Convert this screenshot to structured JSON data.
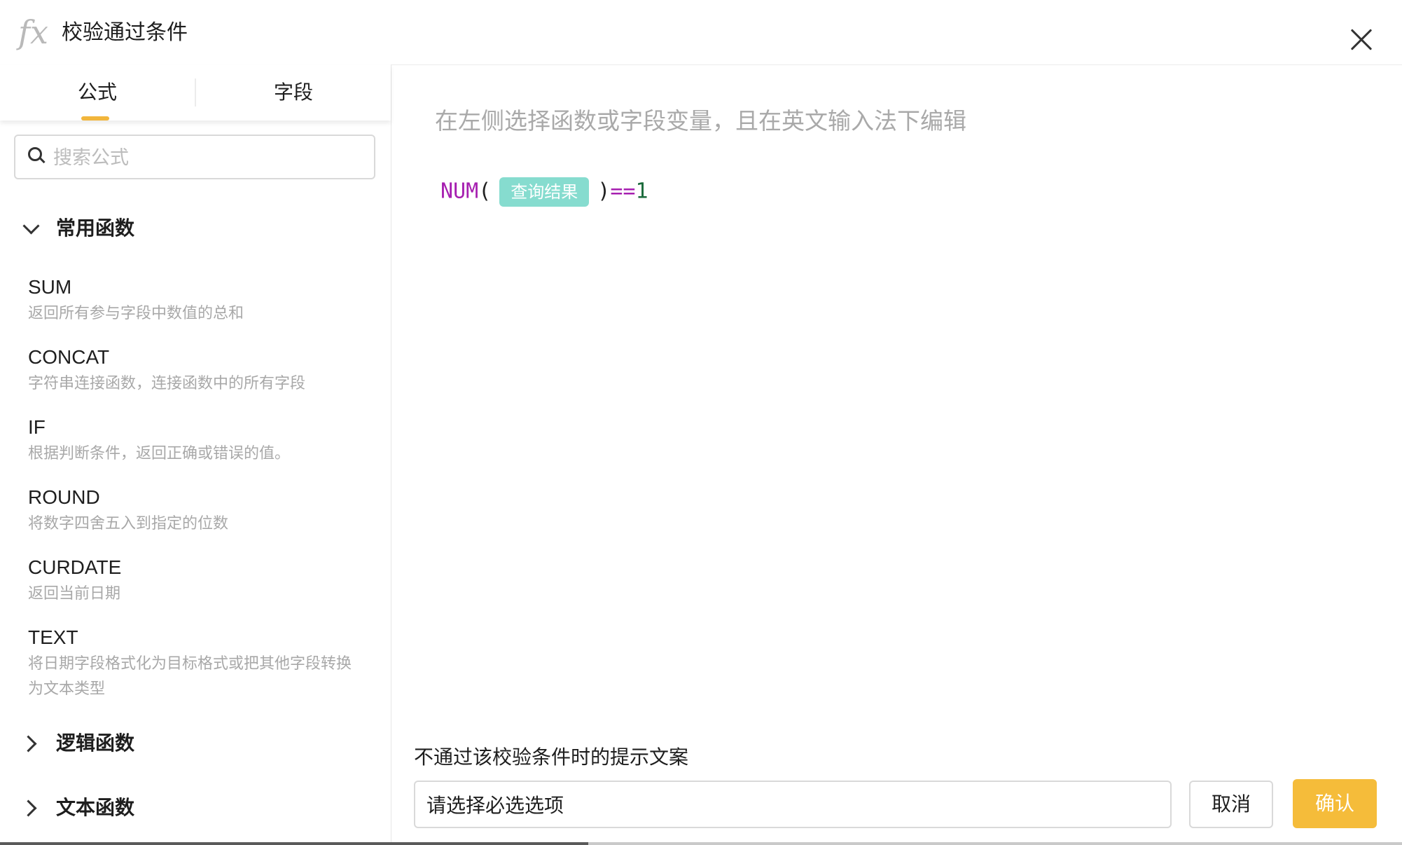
{
  "dialog": {
    "title": "校验通过条件",
    "fx_icon_text": "fx",
    "icons": {
      "fx": "fx-icon",
      "close": "close-icon",
      "search": "search-icon"
    }
  },
  "tabs": [
    {
      "label": "公式",
      "active": true
    },
    {
      "label": "字段",
      "active": false
    }
  ],
  "search": {
    "placeholder": "搜索公式",
    "value": ""
  },
  "groups": [
    {
      "label": "常用函数",
      "expanded": true,
      "items": [
        {
          "name": "SUM",
          "desc": "返回所有参与字段中数值的总和"
        },
        {
          "name": "CONCAT",
          "desc": "字符串连接函数，连接函数中的所有字段"
        },
        {
          "name": "IF",
          "desc": "根据判断条件，返回正确或错误的值。"
        },
        {
          "name": "ROUND",
          "desc": "将数字四舍五入到指定的位数"
        },
        {
          "name": "CURDATE",
          "desc": "返回当前日期"
        },
        {
          "name": "TEXT",
          "desc": "将日期字段格式化为目标格式或把其他字段转换为文本类型"
        }
      ]
    },
    {
      "label": "逻辑函数",
      "expanded": false
    },
    {
      "label": "文本函数",
      "expanded": false
    }
  ],
  "editor": {
    "hint": "在左侧选择函数或字段变量，且在英文输入法下编辑",
    "formula": {
      "func": "NUM",
      "open_paren": "(",
      "field_tag": "查询结果",
      "close_paren": ")",
      "operator": "==",
      "value": "1"
    }
  },
  "error_message": {
    "label": "不通过该校验条件时的提示文案",
    "value": "请选择必选选项"
  },
  "buttons": {
    "cancel": "取消",
    "confirm": "确认"
  },
  "colors": {
    "accent": "#f5bc3a",
    "tab_indicator": "#f2b63c",
    "field_tag_bg": "#86dccf",
    "formula_function": "#a61fb0",
    "formula_number": "#1b6b3b"
  }
}
